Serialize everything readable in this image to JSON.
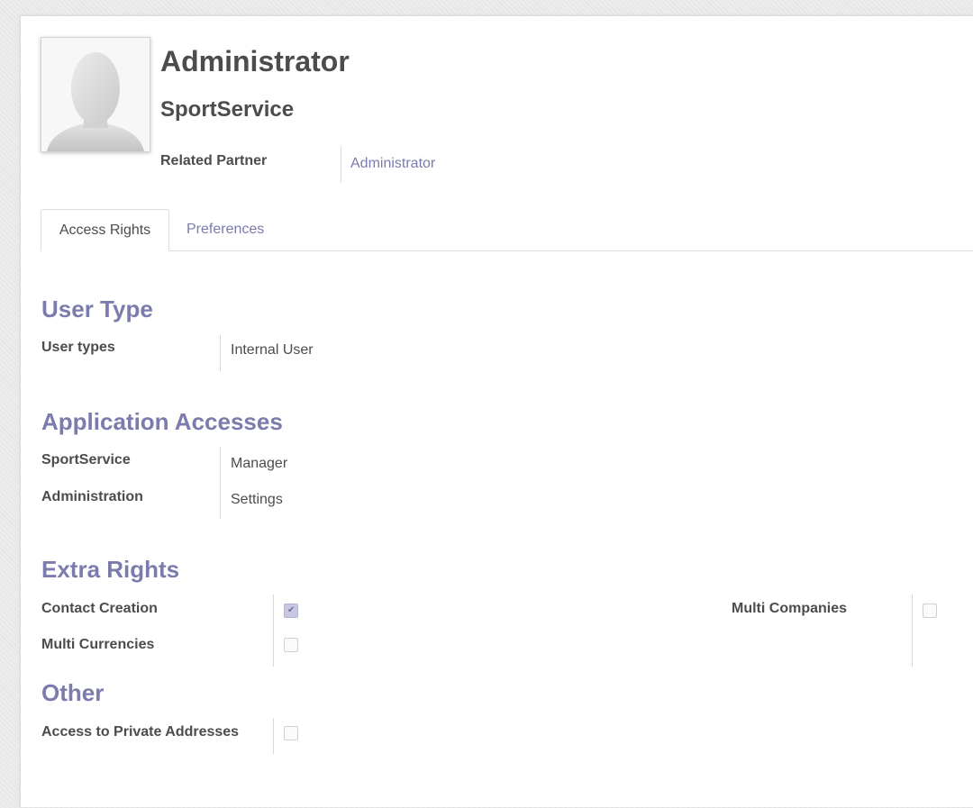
{
  "user": {
    "name": "Administrator",
    "company": "SportService",
    "related_partner_label": "Related Partner",
    "related_partner_value": "Administrator"
  },
  "tabs": [
    {
      "label": "Access Rights",
      "active": true
    },
    {
      "label": "Preferences",
      "active": false
    }
  ],
  "user_type": {
    "title": "User Type",
    "label": "User types",
    "value": "Internal User"
  },
  "application_accesses": {
    "title": "Application Accesses",
    "rows": [
      {
        "label": "SportService",
        "value": "Manager"
      },
      {
        "label": "Administration",
        "value": "Settings"
      }
    ]
  },
  "extra_rights": {
    "title": "Extra Rights",
    "items": [
      {
        "label": "Contact Creation",
        "checked": true
      },
      {
        "label": "Multi Currencies",
        "checked": false
      },
      {
        "label": "Multi Companies",
        "checked": false
      }
    ]
  },
  "other": {
    "title": "Other",
    "items": [
      {
        "label": "Access to Private Addresses",
        "checked": false
      }
    ]
  },
  "colors": {
    "accent": "#7c7bad",
    "text": "#4c4c4c",
    "border": "#dddddd",
    "checked_fill": "#c8c7e0"
  },
  "icons": {
    "avatar": "default-user-silhouette",
    "checkmark": "check-icon"
  }
}
